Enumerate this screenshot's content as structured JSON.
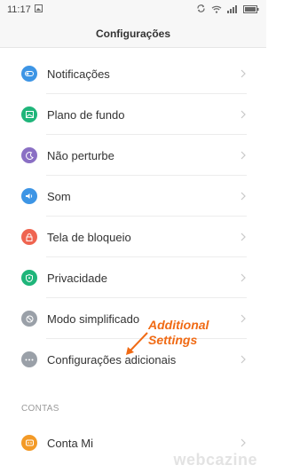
{
  "status": {
    "time": "11:17"
  },
  "header": {
    "title": "Configurações"
  },
  "settings": [
    {
      "label": "Notificações",
      "icon": "toggle-icon",
      "color": "#3d95e5"
    },
    {
      "label": "Plano de fundo",
      "icon": "image-icon",
      "color": "#1fb57a"
    },
    {
      "label": "Não perturbe",
      "icon": "moon-icon",
      "color": "#8a6fc4"
    },
    {
      "label": "Som",
      "icon": "speaker-icon",
      "color": "#3d95e5"
    },
    {
      "label": "Tela de bloqueio",
      "icon": "lock-icon",
      "color": "#ef6450"
    },
    {
      "label": "Privacidade",
      "icon": "shield-icon",
      "color": "#1fb57a"
    },
    {
      "label": "Modo simplificado",
      "icon": "nosign-icon",
      "color": "#9aa0a8"
    },
    {
      "label": "Configurações adicionais",
      "icon": "more-icon",
      "color": "#9aa0a8"
    }
  ],
  "section_accounts": {
    "title": "CONTAS"
  },
  "accounts": [
    {
      "label": "Conta Mi",
      "icon": "mi-icon",
      "color": "#f39a27"
    }
  ],
  "annotation": {
    "line1": "Additional",
    "line2": "Settings",
    "color": "#f06a14"
  },
  "watermark": "webcazine"
}
